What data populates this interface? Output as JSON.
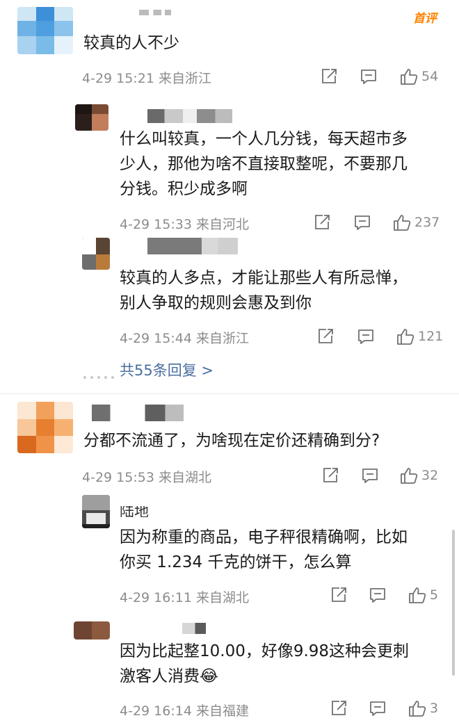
{
  "badge": "首评",
  "comments": [
    {
      "text": "较真的人不少",
      "time": "4-29 15:21",
      "location": "来自浙江",
      "likes": "54"
    },
    {
      "text": "什么叫较真，一个人几分钱，每天超市多\n少人，那他为啥不直接取整呢，不要那几\n分钱。积少成多啊",
      "time": "4-29 15:33",
      "location": "来自河北",
      "likes": "237"
    },
    {
      "text": "较真的人多点，才能让那些人有所忌惮，\n别人争取的规则会惠及到你",
      "time": "4-29 15:44",
      "location": "来自浙江",
      "likes": "121"
    },
    {
      "text": "分都不流通了，为啥现在定价还精确到分?",
      "time": "4-29 15:53",
      "location": "来自湖北",
      "likes": "32"
    },
    {
      "text": "因为称重的商品，电子秤很精确啊，比如\n你买 1.234 千克的饼干，怎么算",
      "time": "4-29 16:11",
      "location": "来自湖北",
      "likes": "5"
    },
    {
      "text": "因为比起整10.00，好像9.98这种会更刺\n激客人消费😂",
      "time": "4-29 16:14",
      "location": "来自福建",
      "likes": "3"
    }
  ],
  "more_replies": "共55条回复 >",
  "partial_name": "陆地",
  "icons": {
    "share": "share-icon",
    "comment": "comment-icon",
    "like": "thumbs-up-icon"
  },
  "colors": {
    "link": "#4a6ea0",
    "meta": "#8c8c8c",
    "badge": "#ff8200"
  }
}
